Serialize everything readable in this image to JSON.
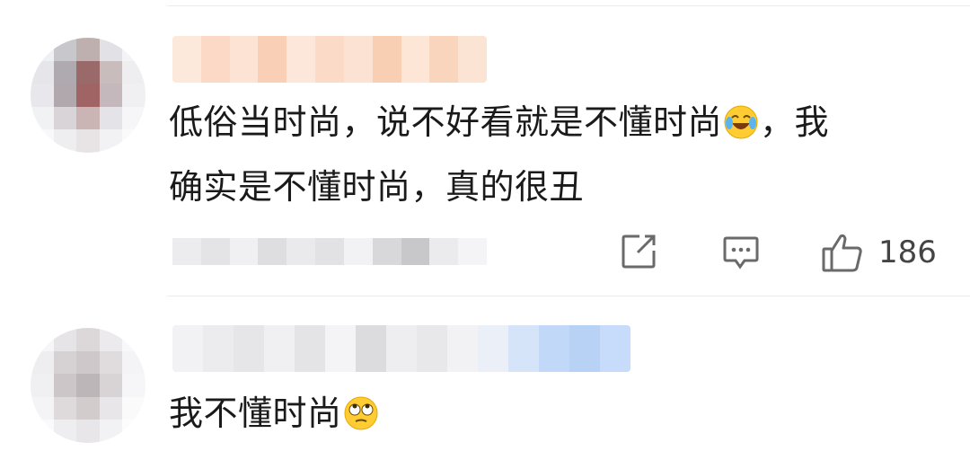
{
  "comments": [
    {
      "text_part1": "低俗当时尚，说不好看就是不懂时尚",
      "emoji1": "laugh-cry-emoji",
      "text_part2": "，我",
      "text_line2": "确实是不懂时尚，真的很丑",
      "like_count": "186"
    },
    {
      "text": "我不懂时尚",
      "emoji": "rolling-eyes-emoji"
    }
  ],
  "icons": {
    "share": "share-icon",
    "comment": "comment-icon",
    "like": "thumbs-up-icon"
  },
  "colors": {
    "text": "#1a1a1a",
    "icon": "#6a6a6a",
    "divider": "#ececec"
  }
}
